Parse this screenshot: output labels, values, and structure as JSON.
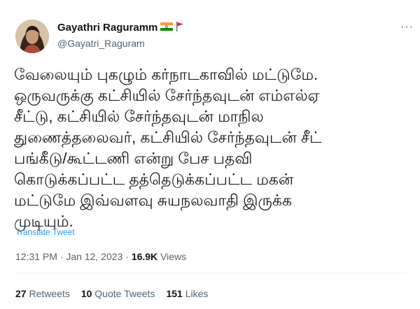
{
  "author": {
    "name": "Gayathri Raguramm",
    "handle": "@Gayatri_Raguram",
    "badges": [
      "india-flag-icon",
      "red-flag-icon"
    ]
  },
  "tweet": {
    "lines": [
      "வேலையும் புகழும் கர்நாடகாவில் மட்டுமே.",
      "ஒருவருக்கு கட்சியில் சேர்ந்தவுடன் எம்எல்ஏ",
      "சீட்டு, கட்சியில் சேர்ந்தவுடன் மாநில",
      "துணைத்தலைவர், கட்சியில் சேர்ந்தவுடன் சீட்",
      "பங்கீடு/கூட்டணி என்று பேச பதவி",
      "கொடுக்கப்பட்ட தத்தெடுக்கப்பட்ட மகன்",
      "மட்டுமே இவ்வளவு சுயநலவாதி இருக்க",
      "முடியும்."
    ],
    "translate_label": "Translate Tweet"
  },
  "meta": {
    "time": "12:31 PM",
    "separator": " · ",
    "date": "Jan 12, 2023",
    "views_count": "16.9K",
    "views_label": "Views"
  },
  "stats": {
    "retweets_count": "27",
    "retweets_label": "Retweets",
    "quotes_count": "10",
    "quotes_label": "Quote Tweets",
    "likes_count": "151",
    "likes_label": "Likes"
  },
  "more_label": "···",
  "colors": {
    "link": "#1d9bf0",
    "secondary_text": "#536471",
    "primary_text": "#0f1419"
  }
}
